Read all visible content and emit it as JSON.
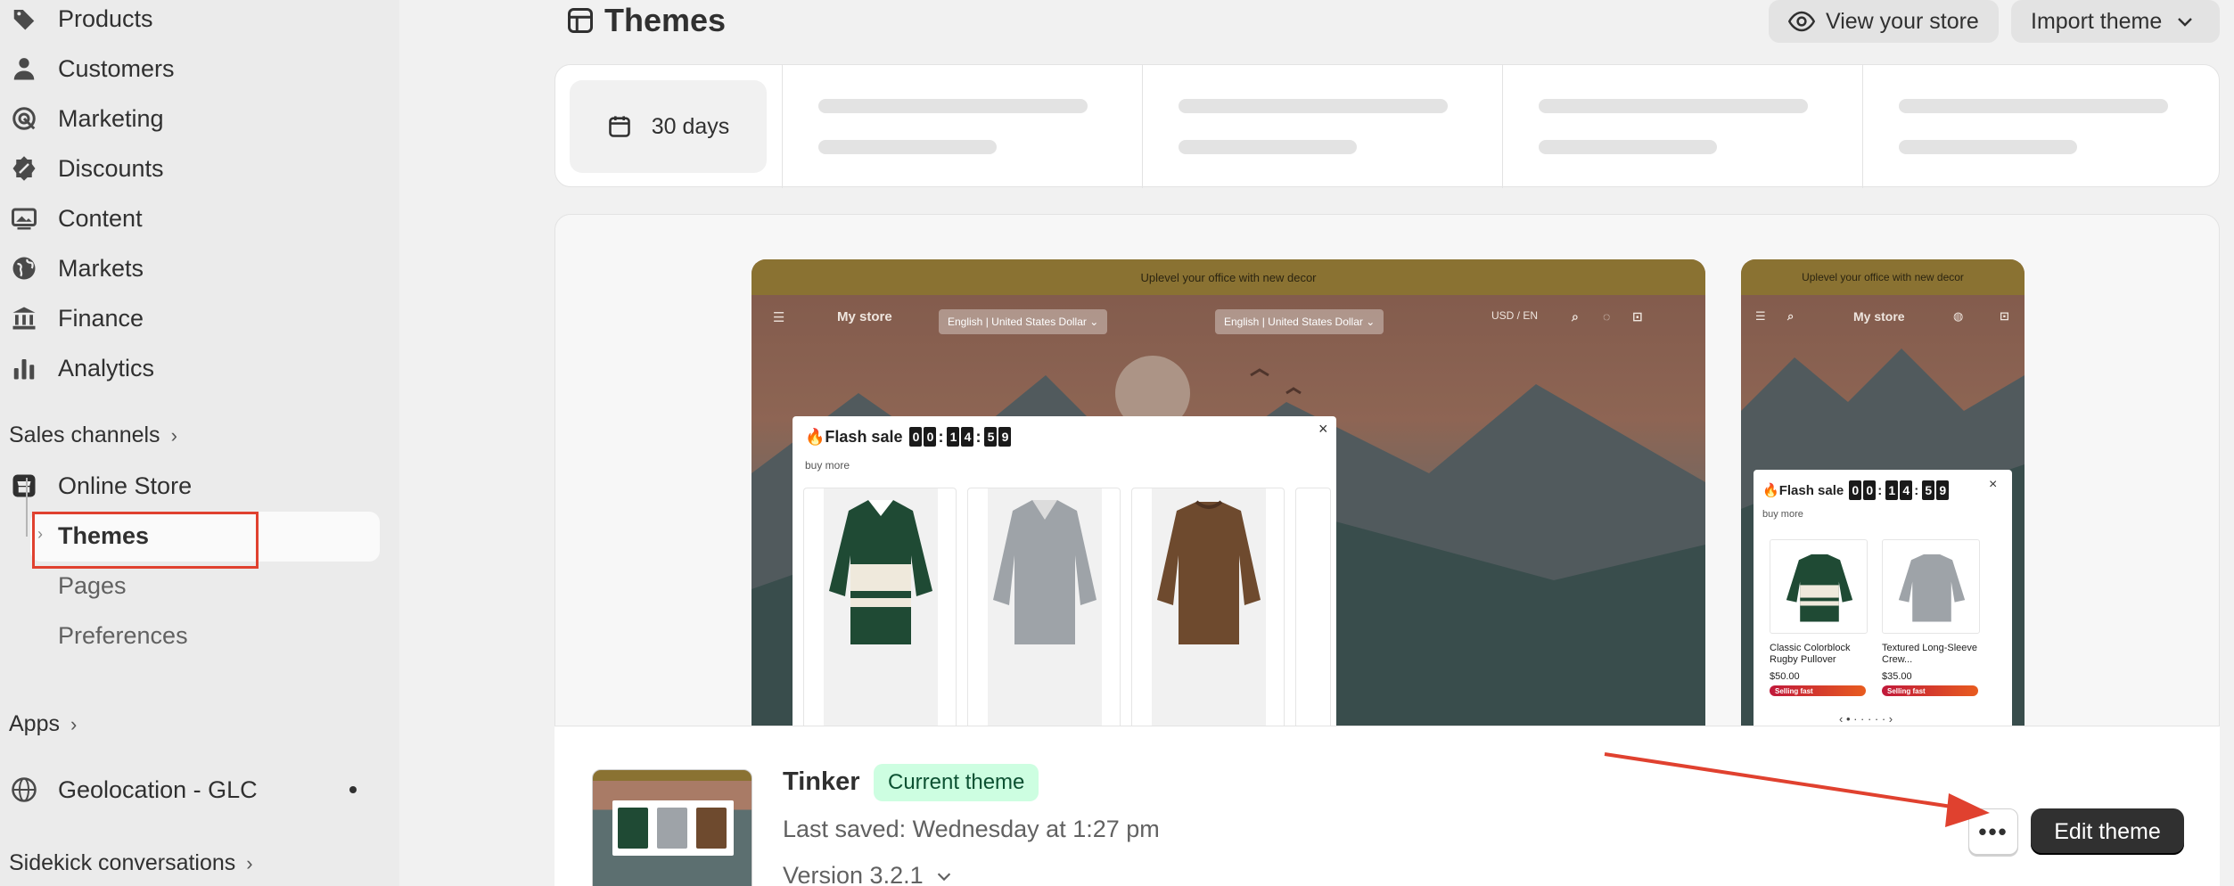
{
  "sidebar": {
    "items": [
      {
        "label": "Products",
        "icon": "tag-icon"
      },
      {
        "label": "Customers",
        "icon": "person-icon"
      },
      {
        "label": "Marketing",
        "icon": "target-icon"
      },
      {
        "label": "Discounts",
        "icon": "discount-icon"
      },
      {
        "label": "Content",
        "icon": "image-icon"
      },
      {
        "label": "Markets",
        "icon": "globe-icon"
      },
      {
        "label": "Finance",
        "icon": "bank-icon"
      },
      {
        "label": "Analytics",
        "icon": "bar-chart-icon"
      }
    ],
    "sales_channels": "Sales channels",
    "online_store": "Online Store",
    "themes": "Themes",
    "pages": "Pages",
    "preferences": "Preferences",
    "apps": "Apps",
    "geolocation": "Geolocation - GLC",
    "sidekick": "Sidekick conversations"
  },
  "header": {
    "title": "Themes",
    "view_store": "View your store",
    "import_theme": "Import theme"
  },
  "stats": {
    "range_label": "30 days"
  },
  "preview": {
    "announcement": "Uplevel your office with new decor",
    "store_name": "My store",
    "lang_label": "English",
    "currency_label": "United States Dollar",
    "usd_en": "USD / EN",
    "flash_sale": "Flash sale",
    "timer": [
      "0",
      "0",
      "1",
      "4",
      "5",
      "9"
    ],
    "buy_more": "buy more",
    "mobile_products": [
      {
        "name": "Classic Colorblock Rugby Pullover",
        "price": "$50.00",
        "badge": "Selling fast"
      },
      {
        "name": "Textured Long-Sleeve Crew...",
        "price": "$35.00",
        "badge": "Selling fast"
      }
    ]
  },
  "theme": {
    "name": "Tinker",
    "current_badge": "Current theme",
    "last_saved": "Last saved: Wednesday at 1:27 pm",
    "version": "Version 3.2.1",
    "edit_button": "Edit theme",
    "more_button": "•••"
  },
  "colors": {
    "annotation_red": "#e0412f",
    "badge_green": "#cdfee1",
    "primary_button": "#303030"
  }
}
